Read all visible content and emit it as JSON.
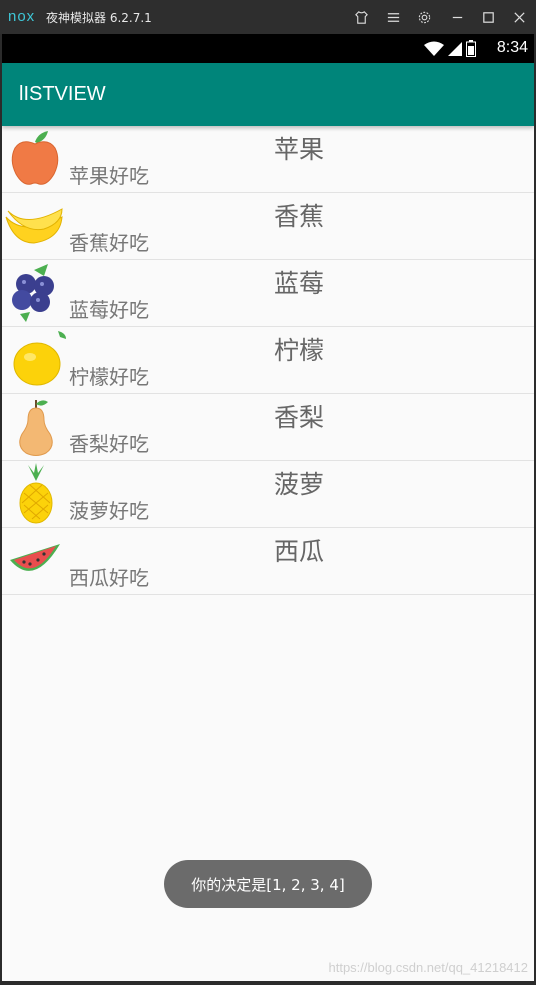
{
  "emulator": {
    "logo": "nox",
    "title": "夜神模拟器 6.2.7.1"
  },
  "status_bar": {
    "time": "8:34"
  },
  "app_bar": {
    "title": "lISTVIEW"
  },
  "list": [
    {
      "name": "苹果",
      "desc": "苹果好吃",
      "icon": "apple-icon"
    },
    {
      "name": "香蕉",
      "desc": "香蕉好吃",
      "icon": "banana-icon"
    },
    {
      "name": "蓝莓",
      "desc": "蓝莓好吃",
      "icon": "blueberry-icon"
    },
    {
      "name": "柠檬",
      "desc": "柠檬好吃",
      "icon": "lemon-icon"
    },
    {
      "name": "香梨",
      "desc": "香梨好吃",
      "icon": "pear-icon"
    },
    {
      "name": "菠萝",
      "desc": "菠萝好吃",
      "icon": "pineapple-icon"
    },
    {
      "name": "西瓜",
      "desc": "西瓜好吃",
      "icon": "watermelon-icon"
    }
  ],
  "toast": {
    "text": "你的决定是[1, 2, 3, 4]"
  },
  "watermark": "https://blog.csdn.net/qq_41218412",
  "colors": {
    "app_bar": "#00857a",
    "toast": "#6b6b6b"
  }
}
